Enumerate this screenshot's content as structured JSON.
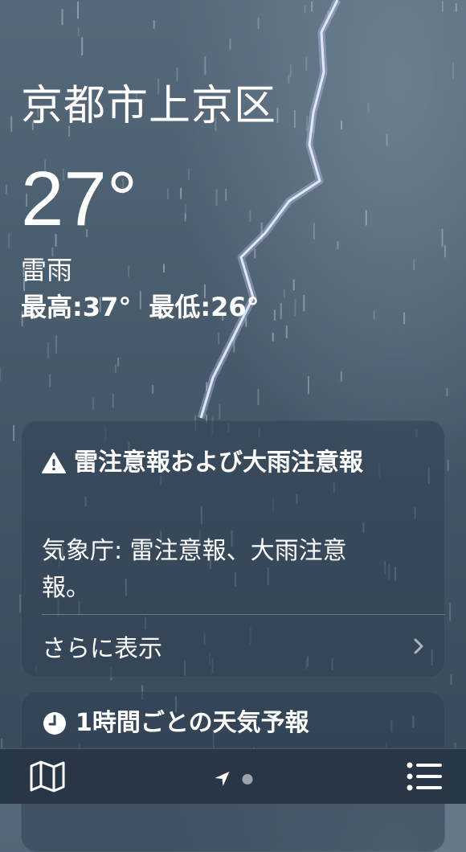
{
  "location": {
    "city": "京都市上京区",
    "temperature": "27°",
    "condition": "雷雨",
    "high": "最高:37°",
    "low": "最低:26°"
  },
  "alert": {
    "title": "雷注意報および大雨注意報",
    "body": "気象庁: 雷注意報、大雨注意報。",
    "more_label": "さらに表示",
    "icon": "warning-triangle-icon"
  },
  "hourly": {
    "title": "1時間ごとの天気予報",
    "icon": "clock-icon"
  },
  "toolbar": {
    "map_icon": "map-icon",
    "location_icon": "location-arrow-icon",
    "list_icon": "list-icon"
  },
  "colors": {
    "sky_top": "#56697a",
    "sky_bottom": "#37495a",
    "card": "#304052",
    "toolbar": "#283646"
  }
}
